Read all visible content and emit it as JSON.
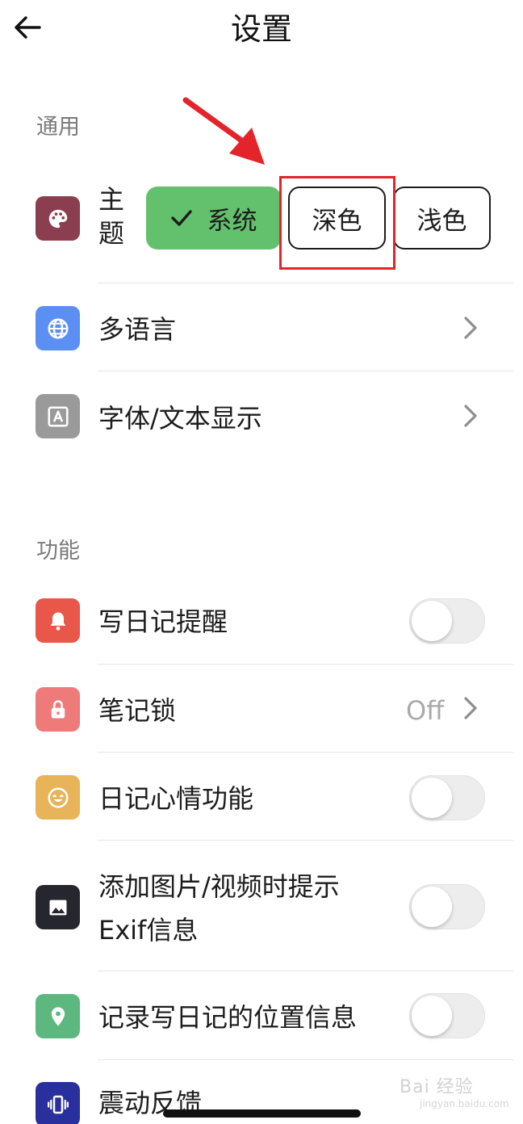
{
  "header": {
    "title": "设置"
  },
  "sections": {
    "general": "通用",
    "features": "功能"
  },
  "theme": {
    "label": "主题",
    "options": [
      "系统",
      "深色",
      "浅色"
    ],
    "selected": "系统"
  },
  "rows": {
    "language": "多语言",
    "font": "字体/文本显示",
    "diary_reminder": "写日记提醒",
    "note_lock": "笔记锁",
    "note_lock_value": "Off",
    "mood": "日记心情功能",
    "exif": "添加图片/视频时提示Exif信息",
    "exif_line1": "添加图片/视频时提示",
    "exif_line2": "Exif信息",
    "location": "记录写日记的位置信息",
    "vibration": "震动反馈"
  },
  "toggles": {
    "diary_reminder": false,
    "mood": false,
    "exif": false,
    "location": false
  },
  "watermark": {
    "text": "Bai 经验",
    "url": "jingyan.baidu.com"
  },
  "colors": {
    "theme_icon": "#8b3e4f",
    "language_icon": "#5b8ff4",
    "font_icon": "#9a9a9a",
    "reminder_icon": "#e8574a",
    "lock_icon": "#ee7b79",
    "mood_icon": "#e8b45a",
    "exif_icon": "#26262e",
    "location_icon": "#5cb87f",
    "vibration_icon": "#2a2f9e",
    "selected_segment": "#63c16d",
    "annotation": "#e3242b"
  }
}
